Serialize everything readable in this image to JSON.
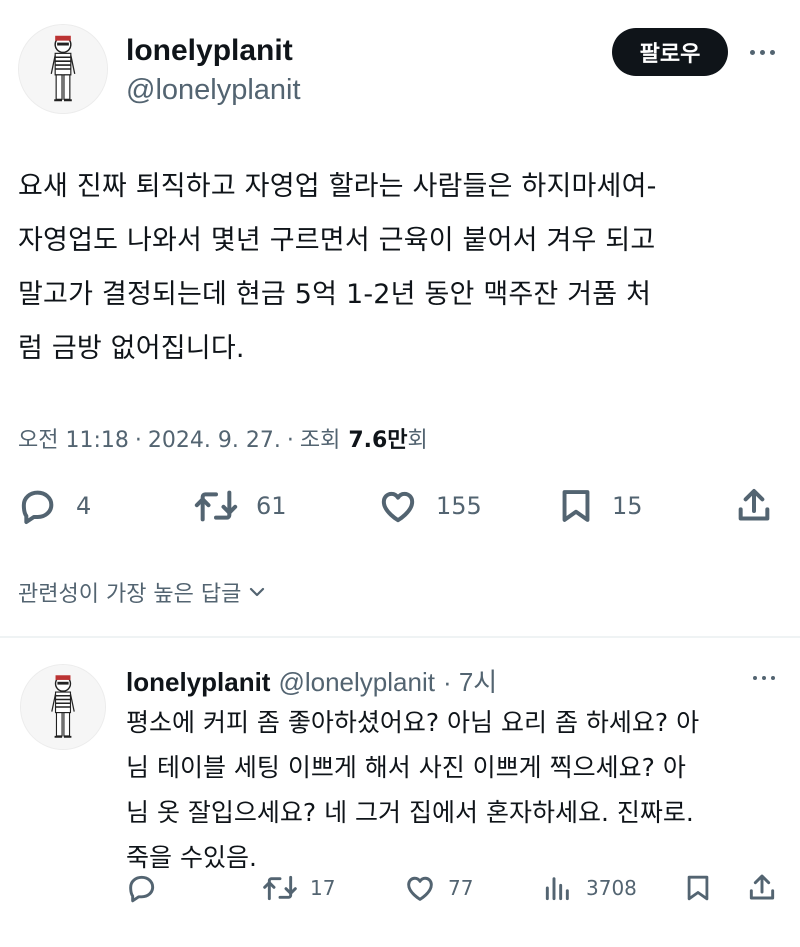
{
  "tweet": {
    "author": {
      "name": "lonelyplanit",
      "handle": "@lonelyplanit"
    },
    "follow_label": "팔로우",
    "text_lines": [
      "요새 진짜 퇴직하고 자영업 할라는 사람들은 하지마세여-",
      "자영업도 나와서 몇년 구르면서 근육이 붙어서 겨우 되고",
      "말고가 결정되는데 현금 5억 1-2년 동안 맥주잔 거품 처",
      "럼 금방 없어집니다."
    ],
    "meta": {
      "time": "오전 11:18",
      "sep1": "·",
      "date": "2024. 9. 27.",
      "sep2": "·",
      "views_label": "조회",
      "views_value": "7.6만",
      "views_suffix": "회"
    },
    "actions": {
      "replies": "4",
      "retweets": "61",
      "likes": "155",
      "bookmarks": "15"
    }
  },
  "replies_sort_label": "관련성이 가장 높은 답글",
  "reply": {
    "author": {
      "name": "lonelyplanit",
      "handle": "@lonelyplanit",
      "time": "· 7시"
    },
    "text_lines": [
      "평소에 커피 좀 좋아하셨어요? 아님 요리 좀 하세요? 아",
      "님 테이블 세팅 이쁘게 해서 사진 이쁘게 찍으세요? 아",
      "님 옷 잘입으세요? 네 그거 집에서 혼자하세요. 진짜로.",
      "죽을 수있음."
    ],
    "actions": {
      "retweets": "17",
      "likes": "77",
      "views": "3708"
    }
  },
  "colors": {
    "text": "#0f1419",
    "secondary": "#536471",
    "button_bg": "#0f1419",
    "divider": "#eff3f4"
  }
}
